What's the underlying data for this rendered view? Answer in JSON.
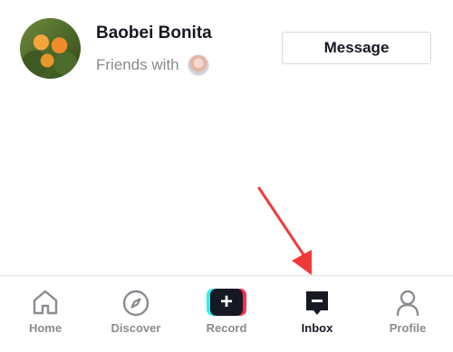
{
  "user": {
    "name": "Baobei Bonita",
    "friends_label": "Friends with",
    "avatar_icon": "orange-flowers-avatar",
    "mutual_friend_icon": "mutual-friend-avatar"
  },
  "actions": {
    "message_label": "Message"
  },
  "annotation": {
    "arrow_color": "#f03a3a"
  },
  "bottom_nav": {
    "items": [
      {
        "label": "Home",
        "icon": "home-icon"
      },
      {
        "label": "Discover",
        "icon": "compass-icon"
      },
      {
        "label": "Record",
        "icon": "plus-icon"
      },
      {
        "label": "Inbox",
        "icon": "inbox-icon",
        "active": true
      },
      {
        "label": "Profile",
        "icon": "profile-icon"
      }
    ]
  }
}
